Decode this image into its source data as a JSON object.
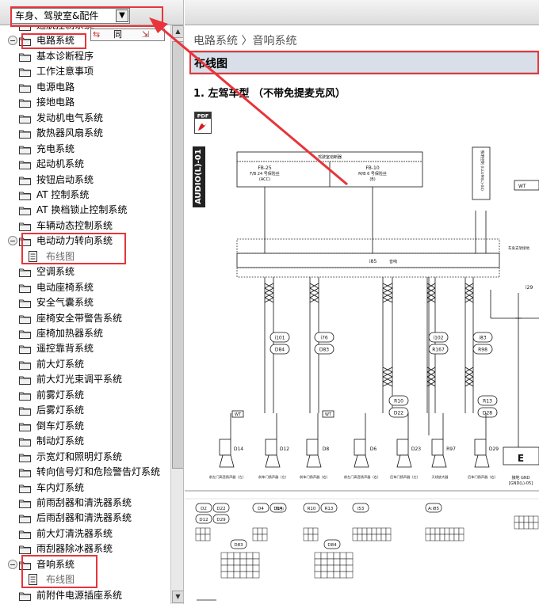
{
  "left_panel": {
    "category_select": {
      "value": "车身、驾驶室&配件"
    },
    "mini_toolbar": {
      "sort_label": "同"
    },
    "tree_items": [
      {
        "label": "巡航控制系统",
        "type": "folder",
        "expanded": false
      },
      {
        "label": "电路系统",
        "type": "folder",
        "expanded": true
      },
      {
        "label": "基本诊断程序",
        "type": "folder"
      },
      {
        "label": "工作注意事项",
        "type": "folder"
      },
      {
        "label": "电源电路",
        "type": "folder"
      },
      {
        "label": "接地电路",
        "type": "folder"
      },
      {
        "label": "发动机电气系统",
        "type": "folder"
      },
      {
        "label": "散热器风扇系统",
        "type": "folder"
      },
      {
        "label": "充电系统",
        "type": "folder"
      },
      {
        "label": "起动机系统",
        "type": "folder"
      },
      {
        "label": "按钮启动系统",
        "type": "folder"
      },
      {
        "label": "AT 控制系统",
        "type": "folder"
      },
      {
        "label": "AT 换档锁止控制系统",
        "type": "folder"
      },
      {
        "label": "车辆动态控制系统",
        "type": "folder"
      },
      {
        "label": "电动动力转向系统",
        "type": "folder",
        "expanded": true
      },
      {
        "label": "布线图",
        "type": "doc"
      },
      {
        "label": "空调系统",
        "type": "folder"
      },
      {
        "label": "电动座椅系统",
        "type": "folder"
      },
      {
        "label": "安全气囊系统",
        "type": "folder"
      },
      {
        "label": "座椅安全带警告系统",
        "type": "folder"
      },
      {
        "label": "座椅加热器系统",
        "type": "folder"
      },
      {
        "label": "遥控靠背系统",
        "type": "folder"
      },
      {
        "label": "前大灯系统",
        "type": "folder"
      },
      {
        "label": "前大灯光束调平系统",
        "type": "folder"
      },
      {
        "label": "前雾灯系统",
        "type": "folder"
      },
      {
        "label": "后雾灯系统",
        "type": "folder"
      },
      {
        "label": "倒车灯系统",
        "type": "folder"
      },
      {
        "label": "制动灯系统",
        "type": "folder"
      },
      {
        "label": "示宽灯和照明灯系统",
        "type": "folder"
      },
      {
        "label": "转向信号灯和危险警告灯系统",
        "type": "folder"
      },
      {
        "label": "车内灯系统",
        "type": "folder"
      },
      {
        "label": "前雨刮器和清洗器系统",
        "type": "folder"
      },
      {
        "label": "后雨刮器和清洗器系统",
        "type": "folder"
      },
      {
        "label": "前大灯清洗器系统",
        "type": "folder"
      },
      {
        "label": "雨刮器除冰器系统",
        "type": "folder"
      },
      {
        "label": "音响系统",
        "type": "folder",
        "expanded": true
      },
      {
        "label": "布线图",
        "type": "doc"
      },
      {
        "label": "前附件电源插座系统",
        "type": "folder"
      }
    ]
  },
  "right_panel": {
    "breadcrumb": "电路系统 〉音响系统",
    "section_title": "布线图",
    "subtitle": "1.  左驾车型 （不带免提麦克风）",
    "pdf_label": "PDF",
    "diagram_tag": "AUDIO(L)-01",
    "diagram": {
      "fuse_box_title": "驾驶室熔断器",
      "fb25": "FB-25",
      "fb25_desc": "F/B 24 号保险丝",
      "fb25_mode": "(ACC)",
      "fb10": "FB-10",
      "fb10_desc": "M/B 6 号保险丝",
      "fb10_mode": "(B)",
      "audio_unit": "音响",
      "connector_i85": "i85",
      "illum_label": "照明控制 (ILLUMI(L)-04)",
      "wt_label": "WT",
      "body_gnd": "车身支架接地",
      "i29": "i29",
      "ground_label": "接地 GND",
      "ground_sub": "[GND(L)-05]",
      "e_label": "E",
      "connectors_mid": [
        "i101",
        "D84",
        "i76",
        "D83",
        "i102",
        "R167",
        "i83",
        "R98"
      ],
      "connectors_low": [
        "R10",
        "D22",
        "R13",
        "D28"
      ],
      "speakers": [
        {
          "id": "D14",
          "label": "前左门高音扬声器（左）"
        },
        {
          "id": "D12",
          "label": "前车门扬声器（左）"
        },
        {
          "id": "D8",
          "label": "前车门扬声器（右）"
        },
        {
          "id": "D6",
          "label": "前左门高音扬声器（右）"
        },
        {
          "id": "D23",
          "label": "后车门扬声器（左）"
        },
        {
          "id": "R97",
          "label": "天线放大器"
        },
        {
          "id": "D29",
          "label": "后车门扬声器（右）"
        }
      ],
      "legend_groups": [
        {
          "ids": [
            "D2",
            "D22",
            "D12",
            "D29"
          ]
        },
        {
          "ids": [
            "D4",
            "D14"
          ],
          "note": "（黑色）"
        },
        {
          "ids": [
            "R10",
            "R13"
          ]
        },
        {
          "ids": [
            "i53"
          ]
        },
        {
          "ids": [
            "i85"
          ],
          "prefix": "A:"
        }
      ],
      "legend_lower": [
        "D83",
        "D84"
      ]
    }
  }
}
